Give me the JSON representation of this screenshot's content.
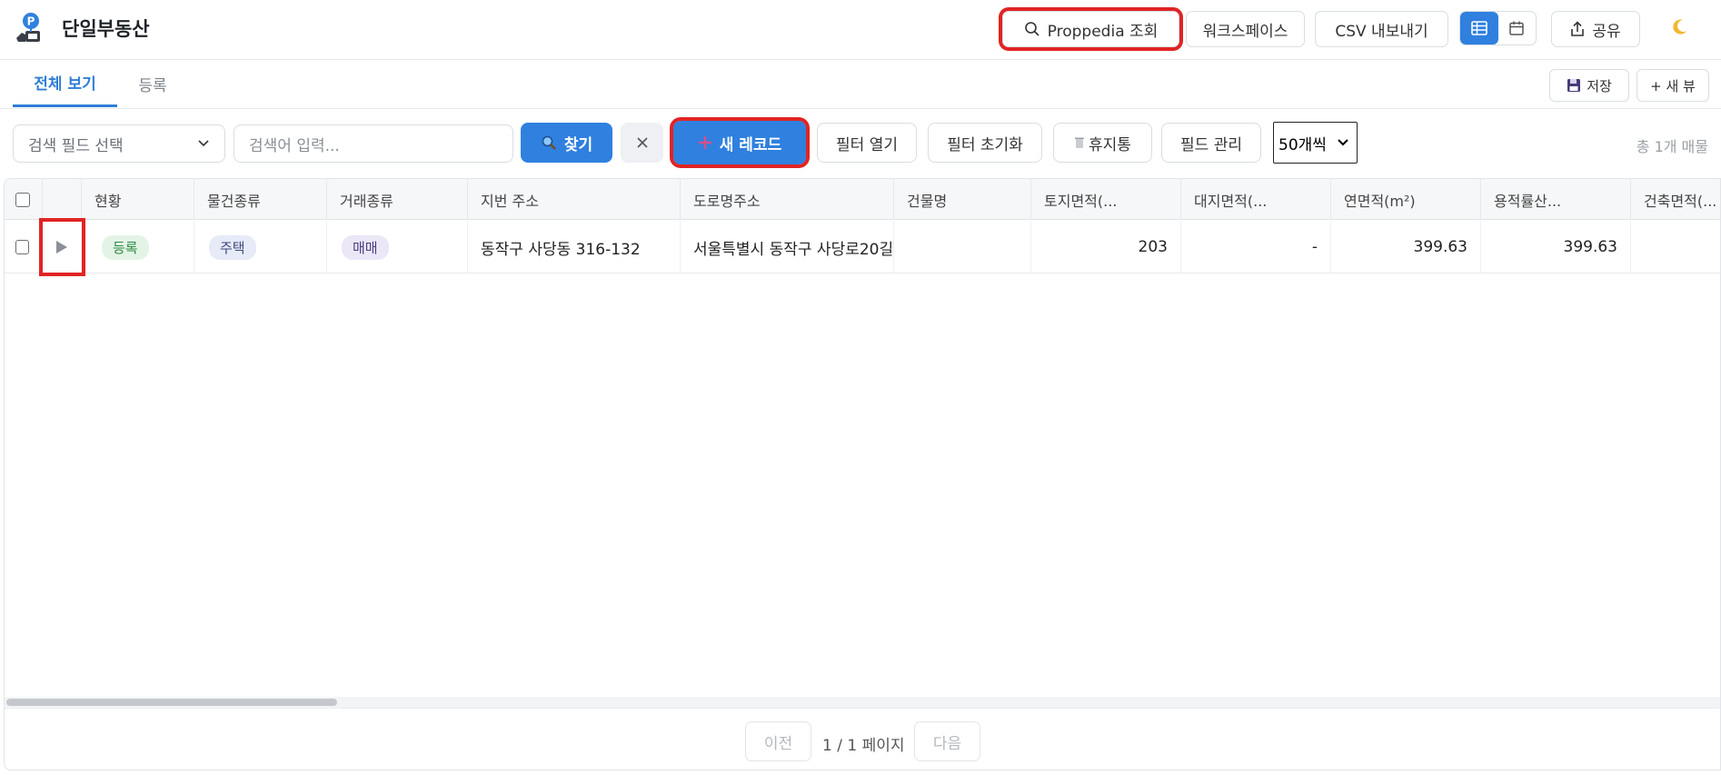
{
  "header": {
    "app_title": "단일부동산",
    "proppedia_label": "Proppedia 조회",
    "workspace_label": "워크스페이스",
    "csv_label": "CSV 내보내기",
    "share_label": "공유",
    "colors": {
      "accent": "#2f80df",
      "highlight": "#e02424"
    }
  },
  "tabs": {
    "items": [
      {
        "label": "전체 보기"
      },
      {
        "label": "등록"
      }
    ],
    "save_label": "저장",
    "new_view_label": "+ 새 뷰"
  },
  "toolbar": {
    "field_select_placeholder": "검색 필드 선택",
    "search_placeholder": "검색어 입력...",
    "find_label": "찾기",
    "new_record_label": "새 레코드",
    "open_filter_label": "필터 열기",
    "reset_filter_label": "필터 초기화",
    "trash_label": "휴지통",
    "manage_fields_label": "필드 관리",
    "page_size": "50개씩",
    "total_label": "총 1개 매물"
  },
  "table": {
    "columns": [
      "현황",
      "물건종류",
      "거래종류",
      "지번 주소",
      "도로명주소",
      "건물명",
      "토지면적(...",
      "대지면적(...",
      "연면적(m²)",
      "용적률산...",
      "건축면적(..."
    ],
    "rows": [
      {
        "status": "등록",
        "property_type": "주택",
        "deal_type": "매매",
        "lot_address": "동작구 사당동 316-132",
        "road_address": "서울특별시 동작구 사당로20길",
        "building_name": "",
        "land_area": "203",
        "site_area": "-",
        "total_floor_area": "399.63",
        "far_area": "399.63",
        "building_area": ""
      }
    ]
  },
  "pagination": {
    "prev_label": "이전",
    "page_info": "1 / 1 페이지",
    "next_label": "다음"
  }
}
